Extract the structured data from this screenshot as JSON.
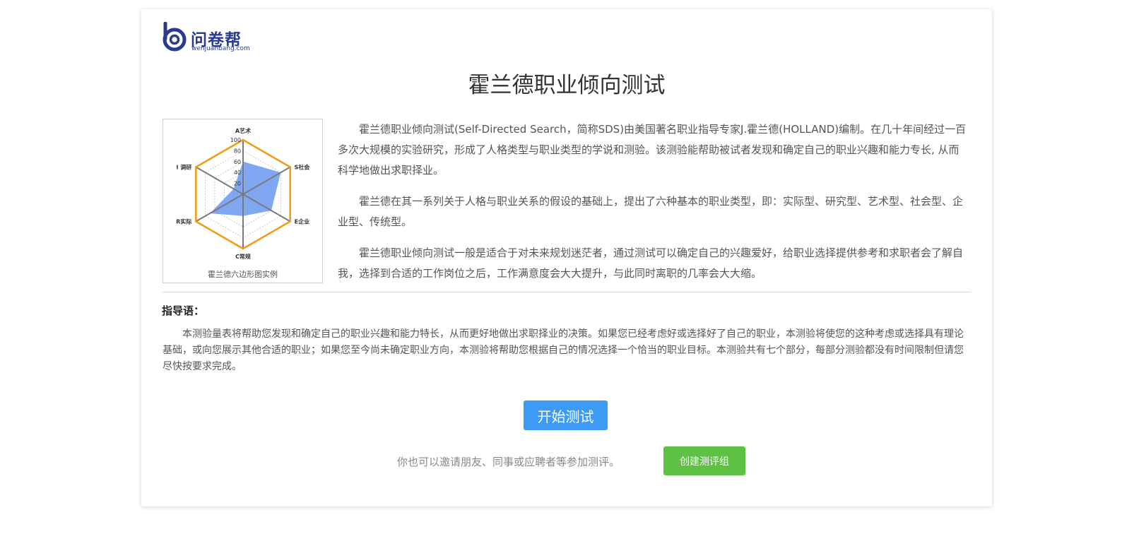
{
  "logo": {
    "name_cn": "问卷帮",
    "name_en": "wenjuanbang.com",
    "icon": "wenjuanbang-logo-icon",
    "color": "#2c3a8c"
  },
  "title": "霍兰德职业倾向测试",
  "figure": {
    "caption": "霍兰德六边形图实例",
    "axes": [
      "A艺术",
      "S社会",
      "E企业",
      "C常规",
      "R实际",
      "I 调研"
    ],
    "scale_labels": [
      "100",
      "80",
      "60",
      "40",
      "20"
    ],
    "values": [
      60,
      80,
      60,
      40,
      70,
      20
    ],
    "outline_color": "#f29b13",
    "fill_color": "#6a98f0"
  },
  "intro": {
    "paragraphs": [
      "霍兰德职业倾向测试(Self-Directed Search，简称SDS)由美国著名职业指导专家J.霍兰德(HOLLAND)编制。在几十年间经过一百多次大规模的实验研究，形成了人格类型与职业类型的学说和测验。该测验能帮助被试者发现和确定自己的职业兴趣和能力专长, 从而科学地做出求职择业。",
      "霍兰德在其一系列关于人格与职业关系的假设的基础上，提出了六种基本的职业类型，即：实际型、研究型、艺术型、社会型、企业型、传统型。",
      "霍兰德职业倾向测试一般是适合于对未来规划迷茫者，通过测试可以确定自己的兴趣爱好，给职业选择提供参考和求职者会了解自我，选择到合适的工作岗位之后，工作满意度会大大提升，与此同时离职的几率会大大缩。"
    ]
  },
  "guide": {
    "label": "指导语：",
    "text": "本测验量表将帮助您发现和确定自己的职业兴趣和能力特长，从而更好地做出求职择业的决策。如果您已经考虑好或选择好了自己的职业，本测验将使您的这种考虑或选择具有理论基础，或向您展示其他合适的职业；如果您至今尚未确定职业方向，本测验将帮助您根据自己的情况选择一个恰当的职业目标。本测验共有七个部分，每部分测验都没有时间限制但请您尽快按要求完成。"
  },
  "actions": {
    "start_label": "开始测试",
    "start_color": "#3e9bf5",
    "invite_text": "你也可以邀请朋友、同事或应聘者等参加测评。",
    "group_label": "创建测评组",
    "group_color": "#5ec144"
  }
}
